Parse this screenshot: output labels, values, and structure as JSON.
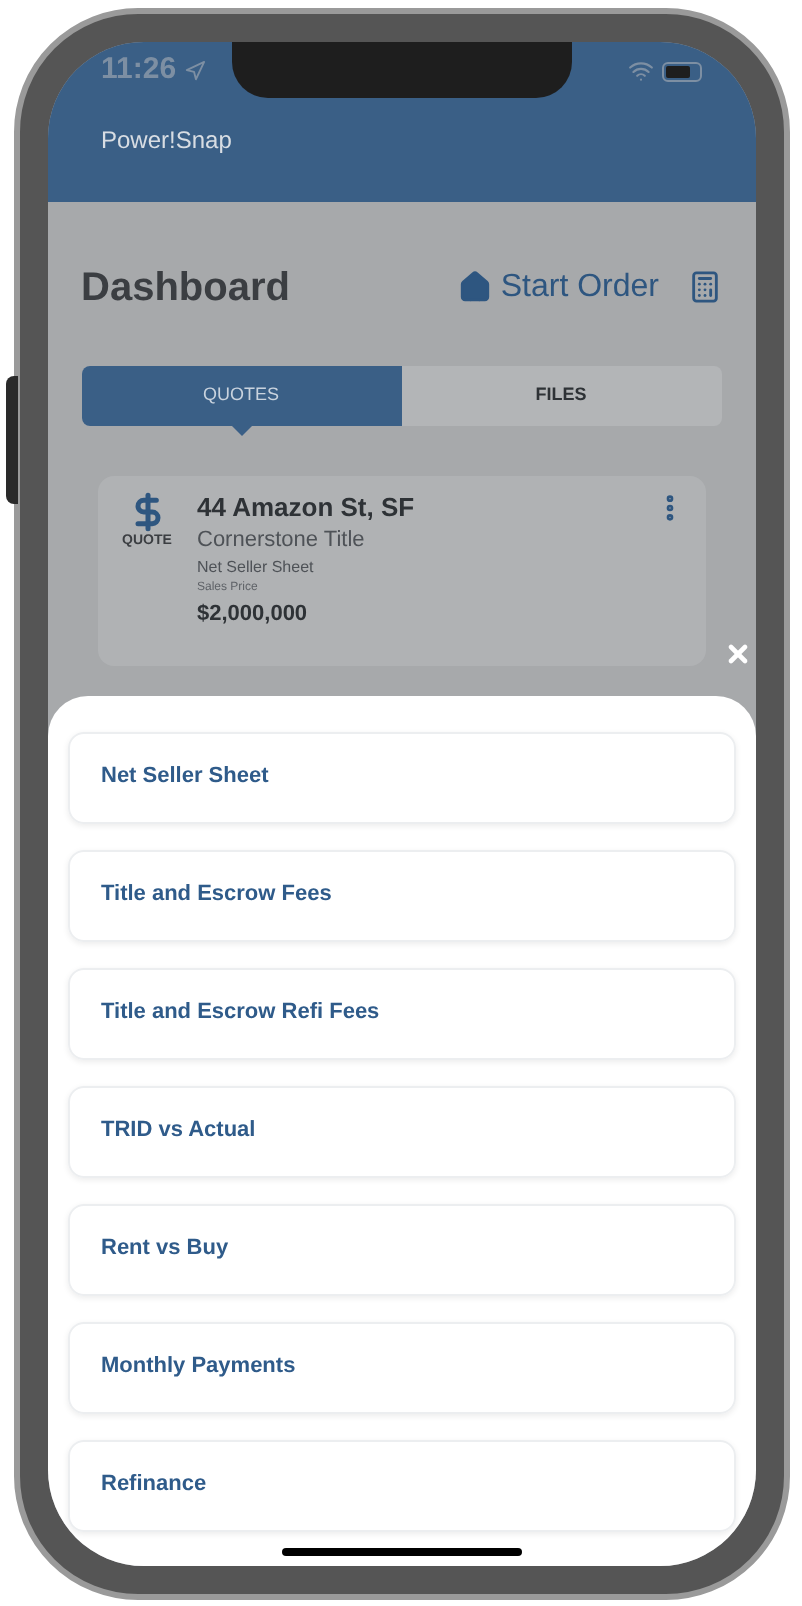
{
  "status_bar": {
    "time": "11:26"
  },
  "app_bar": {
    "title": "Power!Snap"
  },
  "header": {
    "title": "Dashboard",
    "start_order": "Start Order"
  },
  "tabs": [
    {
      "label": "QUOTES",
      "selected": true
    },
    {
      "label": "FILES",
      "selected": false
    }
  ],
  "quote_card": {
    "badge": "QUOTE",
    "address": "44 Amazon St, SF",
    "company": "Cornerstone Title",
    "type": "Net Seller Sheet",
    "price_label": "Sales Price",
    "price": "$2,000,000"
  },
  "sheet_items": [
    {
      "label": "Net Seller Sheet"
    },
    {
      "label": "Title and Escrow Fees"
    },
    {
      "label": "Title and Escrow Refi Fees"
    },
    {
      "label": "TRID vs Actual"
    },
    {
      "label": "Rent vs Buy"
    },
    {
      "label": "Monthly Payments"
    },
    {
      "label": "Refinance"
    }
  ]
}
